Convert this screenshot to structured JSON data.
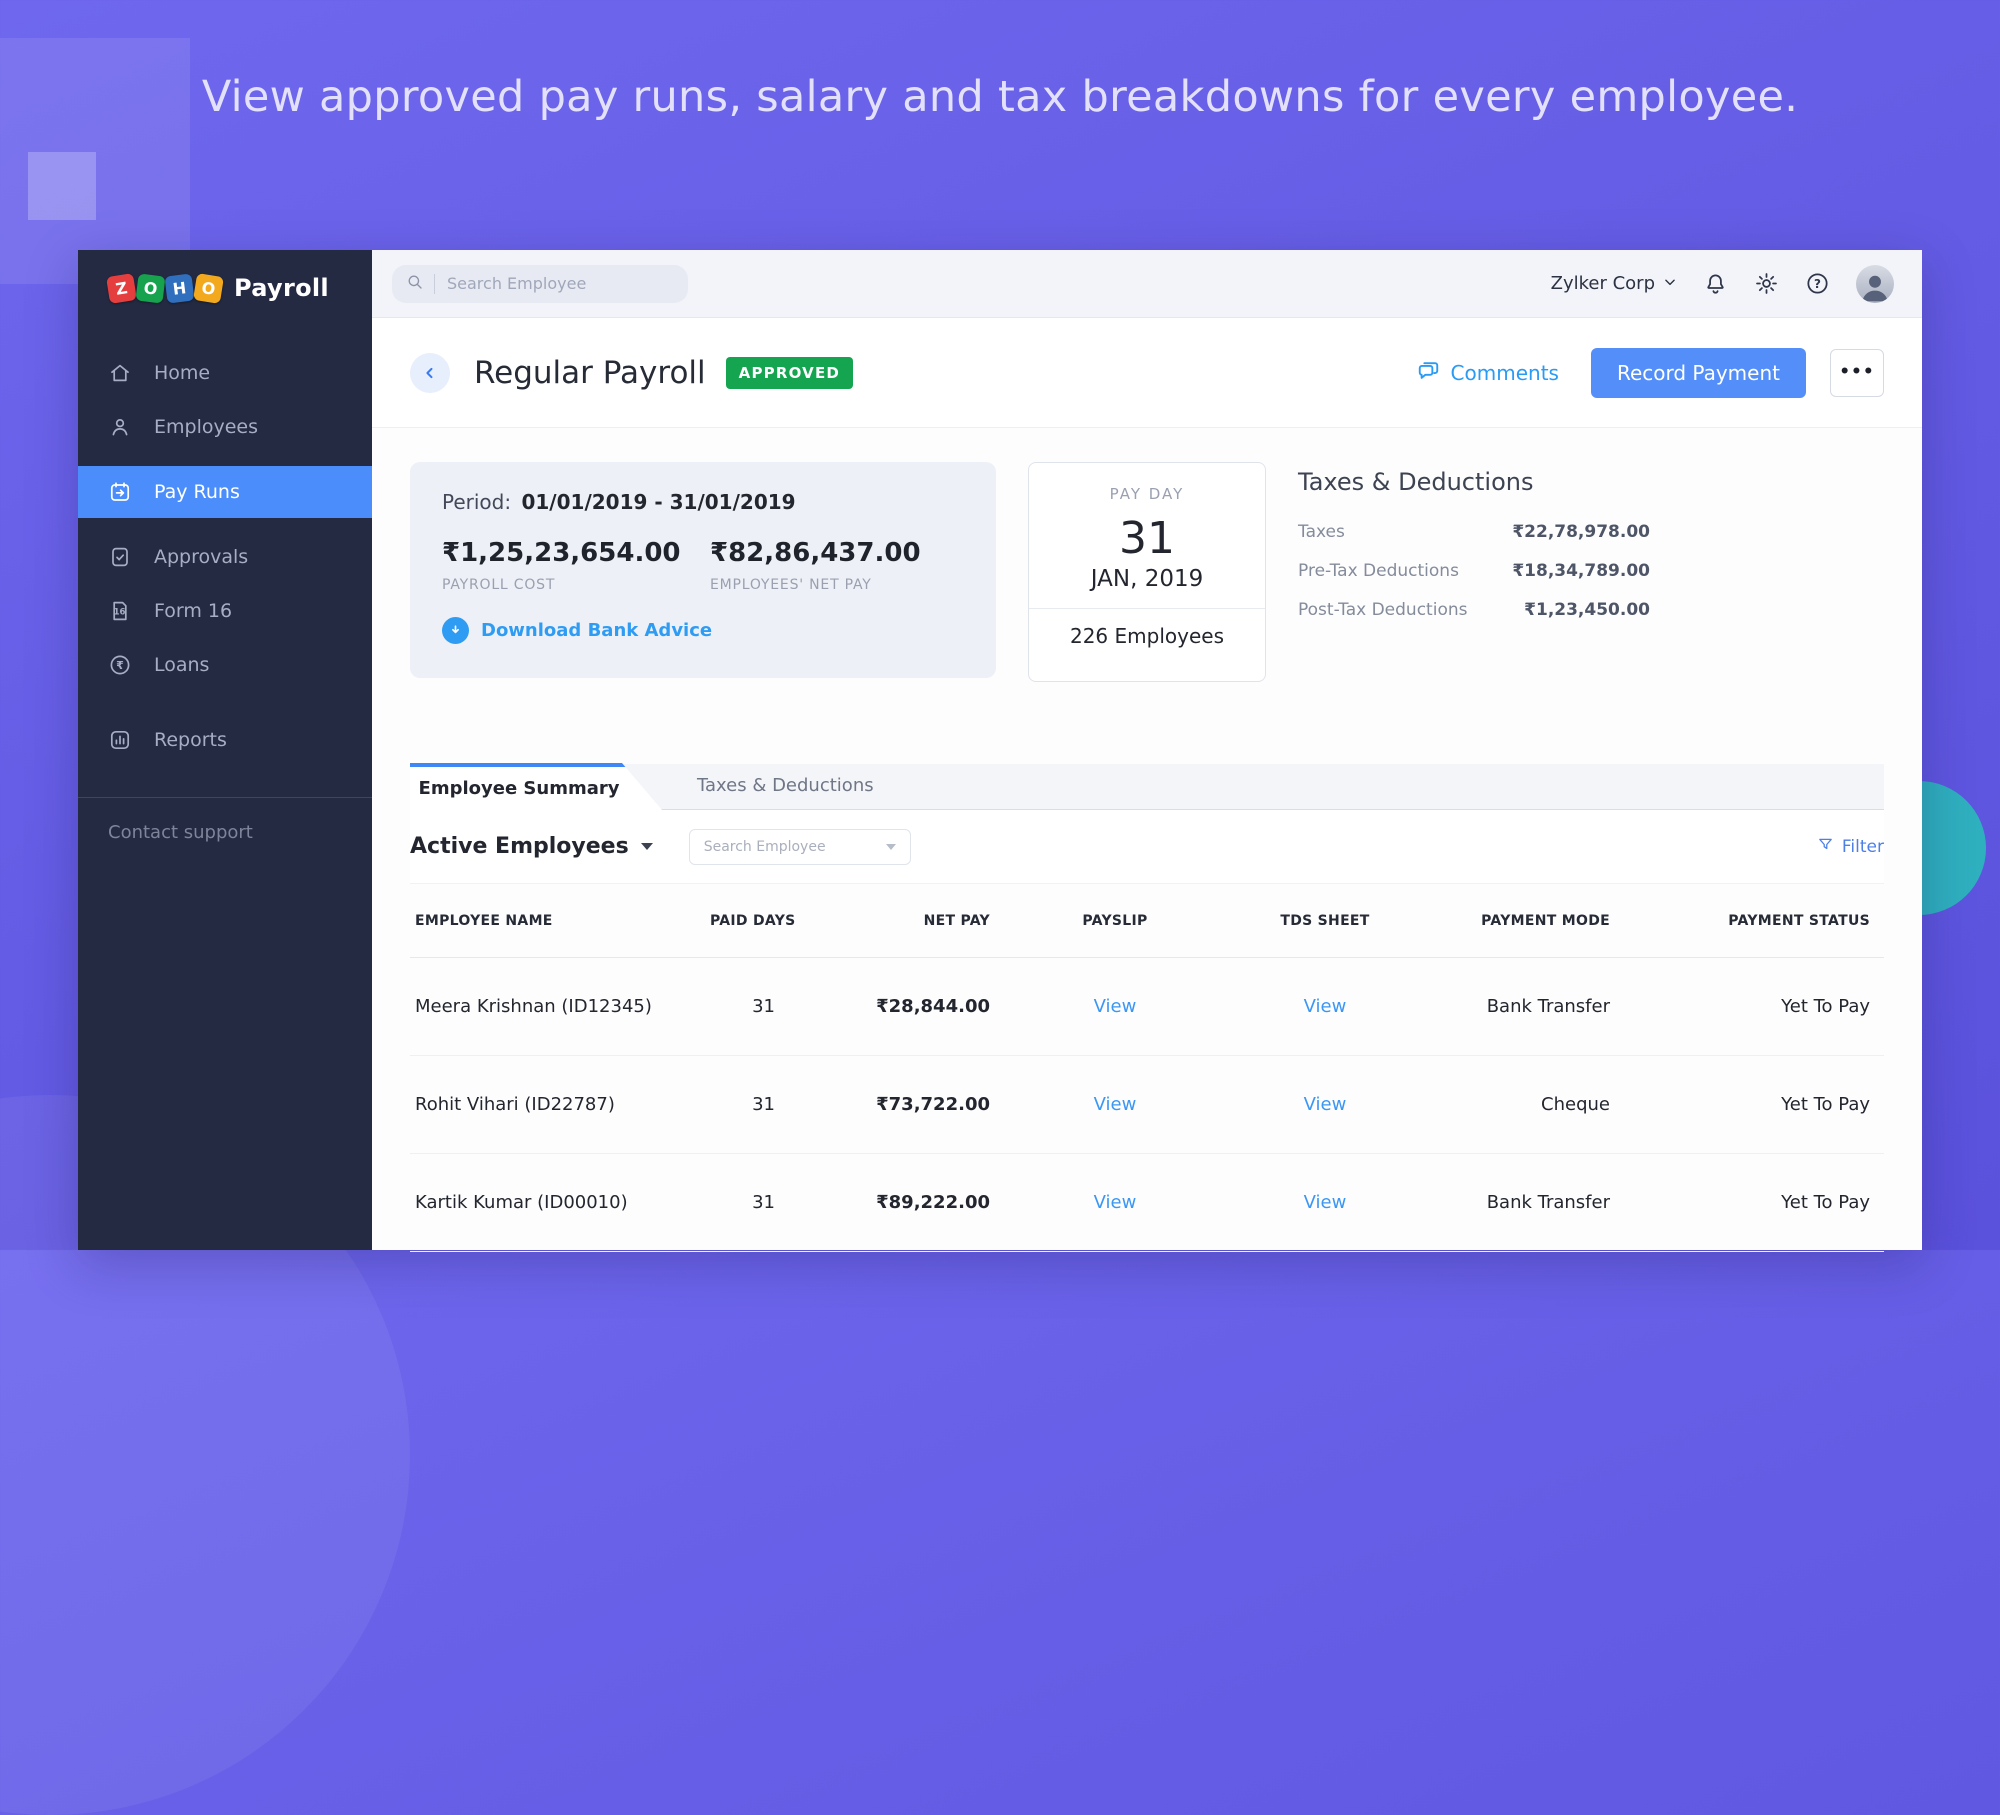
{
  "hero": {
    "headline": "View approved pay runs, salary and tax breakdowns for every employee."
  },
  "brand": {
    "logo_tiles": [
      {
        "letter": "Z",
        "color": "#e53e3e"
      },
      {
        "letter": "O",
        "color": "#17a24e"
      },
      {
        "letter": "H",
        "color": "#2f6fbe"
      },
      {
        "letter": "O",
        "color": "#f2a91e"
      }
    ],
    "product": "Payroll"
  },
  "sidebar": {
    "items": [
      {
        "label": "Home",
        "icon": "home-icon",
        "active": false
      },
      {
        "label": "Employees",
        "icon": "employees-icon",
        "active": false
      },
      {
        "label": "Pay Runs",
        "icon": "pay-runs-icon",
        "active": true
      },
      {
        "label": "Approvals",
        "icon": "approvals-icon",
        "active": false
      },
      {
        "label": "Form 16",
        "icon": "form16-icon",
        "active": false
      },
      {
        "label": "Loans",
        "icon": "loans-icon",
        "active": false
      },
      {
        "label": "Reports",
        "icon": "reports-icon",
        "active": false
      }
    ],
    "footer_label": "Contact support"
  },
  "topbar": {
    "search_placeholder": "Search Employee",
    "org": "Zylker Corp",
    "icons": [
      "search-icon",
      "chevron-down-icon",
      "bell-icon",
      "gear-icon",
      "help-icon",
      "user-avatar"
    ]
  },
  "header": {
    "title": "Regular Payroll",
    "status": "APPROVED",
    "comments_label": "Comments",
    "record_payment_label": "Record Payment",
    "more_label": "•••"
  },
  "summary": {
    "period_label": "Period:",
    "period_value": "01/01/2019 - 31/01/2019",
    "payroll_cost": "₹1,25,23,654.00",
    "payroll_cost_label": "PAYROLL COST",
    "net_pay": "₹82,86,437.00",
    "net_pay_label": "EMPLOYEES' NET PAY",
    "download_label": "Download Bank Advice",
    "payday": {
      "label": "PAY DAY",
      "day": "31",
      "month": "JAN, 2019",
      "employees": "226 Employees"
    },
    "taxes": {
      "heading": "Taxes & Deductions",
      "rows": [
        {
          "label": "Taxes",
          "value": "₹22,78,978.00"
        },
        {
          "label": "Pre-Tax Deductions",
          "value": "₹18,34,789.00"
        },
        {
          "label": "Post-Tax Deductions",
          "value": "₹1,23,450.00"
        }
      ]
    }
  },
  "tabs": [
    {
      "label": "Employee Summary",
      "active": true
    },
    {
      "label": "Taxes & Deductions",
      "active": false
    }
  ],
  "filter_row": {
    "dropdown_label": "Active Employees",
    "search_placeholder": "Search Employee",
    "filter_label": "Filter"
  },
  "table": {
    "columns": [
      "EMPLOYEE NAME",
      "PAID DAYS",
      "NET PAY",
      "PAYSLIP",
      "TDS SHEET",
      "PAYMENT MODE",
      "PAYMENT STATUS"
    ],
    "rows": [
      {
        "name": "Meera Krishnan (ID12345)",
        "paid_days": "31",
        "net_pay": "₹28,844.00",
        "payslip": "View",
        "tds": "View",
        "mode": "Bank Transfer",
        "status": "Yet To Pay"
      },
      {
        "name": "Rohit Vihari (ID22787)",
        "paid_days": "31",
        "net_pay": "₹73,722.00",
        "payslip": "View",
        "tds": "View",
        "mode": "Cheque",
        "status": "Yet To Pay"
      },
      {
        "name": "Kartik Kumar (ID00010)",
        "paid_days": "31",
        "net_pay": "₹89,222.00",
        "payslip": "View",
        "tds": "View",
        "mode": "Bank Transfer",
        "status": "Yet To Pay"
      }
    ]
  }
}
